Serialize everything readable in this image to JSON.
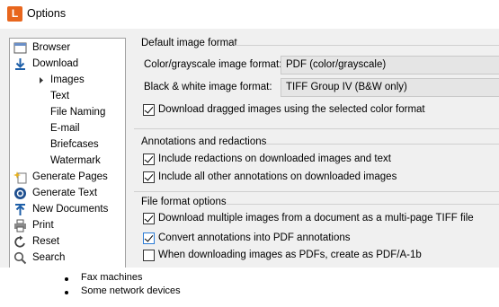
{
  "window": {
    "title": "Options",
    "app_icon_letter": "L"
  },
  "sidebar": {
    "items": [
      {
        "label": "Browser"
      },
      {
        "label": "Download"
      },
      {
        "label": "Images"
      },
      {
        "label": "Text"
      },
      {
        "label": "File Naming"
      },
      {
        "label": "E-mail"
      },
      {
        "label": "Briefcases"
      },
      {
        "label": "Watermark"
      },
      {
        "label": "Generate Pages"
      },
      {
        "label": "Generate Text"
      },
      {
        "label": "New Documents"
      },
      {
        "label": "Print"
      },
      {
        "label": "Reset"
      },
      {
        "label": "Search"
      }
    ],
    "selected": "Images"
  },
  "default_image_format": {
    "title": "Default image format",
    "color_label": "Color/grayscale image format:",
    "color_value": "PDF (color/grayscale)",
    "bw_label": "Black & white image format:",
    "bw_value": "TIFF Group IV (B&W only)",
    "drag_label": "Download dragged images using the selected color format",
    "drag_checked": true
  },
  "annotations": {
    "title": "Annotations and redactions",
    "redactions_label": "Include redactions on downloaded images and text",
    "redactions_checked": true,
    "other_label": "Include all other annotations on downloaded images",
    "other_checked": true
  },
  "file_format": {
    "title": "File format options",
    "multipage_label": "Download multiple images from a document as a multi-page TIFF file",
    "multipage_checked": true,
    "convert_label": "Convert annotations into PDF annotations",
    "convert_checked": true,
    "pdfa_label": "When downloading images as PDFs, create as PDF/A-1b",
    "pdfa_checked": false
  },
  "document": {
    "bullets": [
      "Fax machines",
      "Some network devices"
    ]
  },
  "colors": {
    "app_icon": "#e8661d",
    "dialog_bg": "#f0f0f0",
    "focus_border": "#2a7ad5"
  }
}
